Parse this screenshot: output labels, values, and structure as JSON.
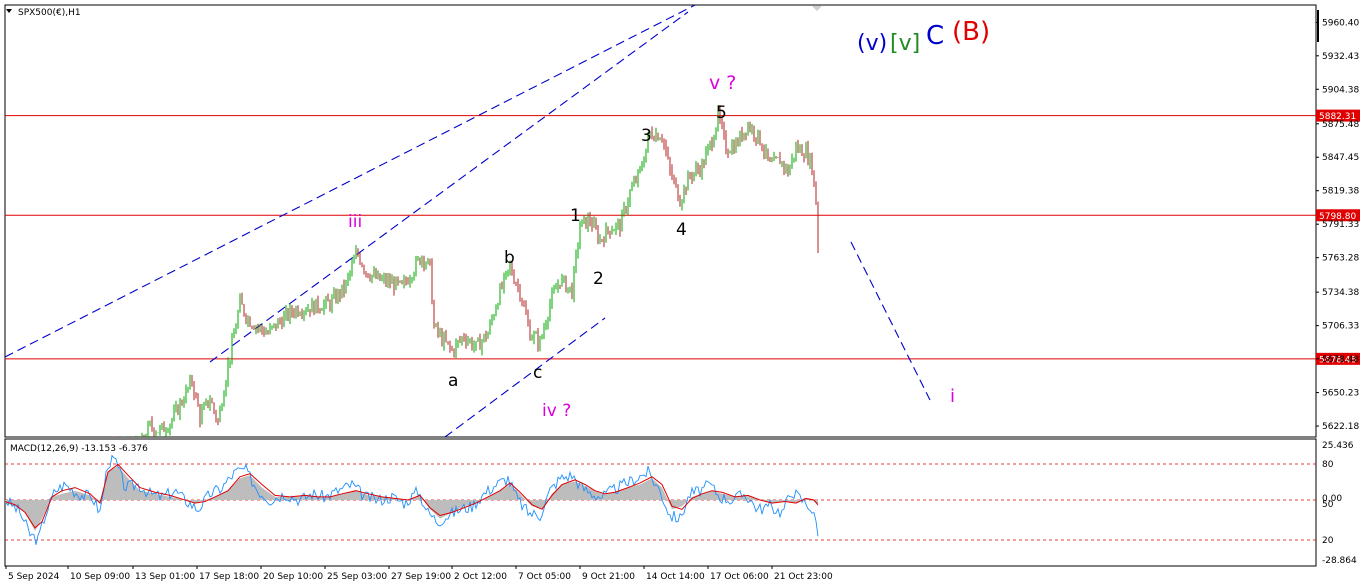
{
  "header": {
    "symbol": "SPX500(€),H1",
    "macd_label": "MACD(12,26,9) -13.153 -6.376"
  },
  "colors": {
    "up": "#00aa00",
    "down": "#b22222",
    "level": "#e00000",
    "trend": "#0000cc",
    "macd_hist": "#bdbdbd",
    "macd_main": "#1e90ff",
    "macd_signal": "#e00000",
    "label_magenta": "#dd00dd",
    "label_black": "#000000",
    "label_blue": "#0000cc",
    "label_green": "#228b22",
    "label_red": "#e00000"
  },
  "chart_data": [
    {
      "type": "candlestick",
      "ylim": [
        5613,
        5975
      ],
      "y_ticks": [
        "5960.40",
        "5932.43",
        "5904.38",
        "5875.48",
        "5847.45",
        "5819.38",
        "5791.33",
        "5763.28",
        "5734.38",
        "5706.33",
        "5678.48",
        "5650.23",
        "5622.18"
      ],
      "x_labels": [
        "5 Sep 2024",
        "10 Sep 09:00",
        "13 Sep 01:00",
        "17 Sep 18:00",
        "20 Sep 10:00",
        "25 Sep 03:00",
        "27 Sep 19:00",
        "2 Oct 12:00",
        "7 Oct 05:00",
        "9 Oct 21:00",
        "14 Oct 14:00",
        "17 Oct 06:00",
        "21 Oct 23:00"
      ],
      "price_levels": [
        {
          "value": 5882.31,
          "label": "5882.31"
        },
        {
          "value": 5798.8,
          "label": "5798.80"
        },
        {
          "value": 5678.48,
          "label": "5678.48"
        }
      ],
      "price_path": [
        [
          0,
          5600
        ],
        [
          140,
          5605
        ],
        [
          150,
          5622
        ],
        [
          160,
          5618
        ],
        [
          170,
          5625
        ],
        [
          180,
          5640
        ],
        [
          192,
          5660
        ],
        [
          200,
          5630
        ],
        [
          210,
          5645
        ],
        [
          218,
          5625
        ],
        [
          225,
          5660
        ],
        [
          232,
          5690
        ],
        [
          240,
          5725
        ],
        [
          248,
          5712
        ],
        [
          258,
          5705
        ],
        [
          268,
          5700
        ],
        [
          280,
          5710
        ],
        [
          295,
          5720
        ],
        [
          312,
          5722
        ],
        [
          330,
          5725
        ],
        [
          345,
          5738
        ],
        [
          357,
          5768
        ],
        [
          366,
          5752
        ],
        [
          378,
          5745
        ],
        [
          392,
          5742
        ],
        [
          402,
          5738
        ],
        [
          412,
          5752
        ],
        [
          422,
          5765
        ],
        [
          430,
          5755
        ],
        [
          434,
          5705
        ],
        [
          442,
          5695
        ],
        [
          452,
          5685
        ],
        [
          464,
          5698
        ],
        [
          476,
          5688
        ],
        [
          488,
          5700
        ],
        [
          498,
          5730
        ],
        [
          510,
          5755
        ],
        [
          520,
          5735
        ],
        [
          530,
          5700
        ],
        [
          540,
          5692
        ],
        [
          550,
          5725
        ],
        [
          560,
          5745
        ],
        [
          572,
          5735
        ],
        [
          580,
          5790
        ],
        [
          590,
          5795
        ],
        [
          600,
          5778
        ],
        [
          610,
          5788
        ],
        [
          620,
          5790
        ],
        [
          630,
          5818
        ],
        [
          640,
          5835
        ],
        [
          650,
          5868
        ],
        [
          662,
          5866
        ],
        [
          670,
          5835
        ],
        [
          680,
          5812
        ],
        [
          690,
          5832
        ],
        [
          702,
          5840
        ],
        [
          712,
          5862
        ],
        [
          718,
          5882
        ],
        [
          726,
          5855
        ],
        [
          736,
          5858
        ],
        [
          748,
          5875
        ],
        [
          760,
          5862
        ],
        [
          770,
          5840
        ],
        [
          780,
          5845
        ],
        [
          788,
          5835
        ],
        [
          796,
          5855
        ],
        [
          806,
          5852
        ],
        [
          812,
          5840
        ],
        [
          816,
          5810
        ],
        [
          818,
          5770
        ]
      ],
      "wave_labels": [
        {
          "text": "iii",
          "color": "label_magenta"
        },
        {
          "text": "b",
          "color": "label_black"
        },
        {
          "text": "1",
          "color": "label_black"
        },
        {
          "text": "2",
          "color": "label_black"
        },
        {
          "text": "3",
          "color": "label_black"
        },
        {
          "text": "4",
          "color": "label_black"
        },
        {
          "text": "5",
          "color": "label_black"
        },
        {
          "text": "v ?",
          "color": "label_magenta"
        },
        {
          "text": "a",
          "color": "label_black"
        },
        {
          "text": "c",
          "color": "label_black"
        },
        {
          "text": "iv ?",
          "color": "label_magenta"
        },
        {
          "text": "i",
          "color": "label_magenta"
        },
        {
          "text": "(v)",
          "color": "label_blue"
        },
        {
          "text": "[v]",
          "color": "label_green"
        },
        {
          "text": "C",
          "color": "label_blue"
        },
        {
          "text": "(B)",
          "color": "label_red"
        }
      ]
    },
    {
      "type": "macd",
      "ylim": [
        -28.864,
        25.436
      ],
      "y_ticks": [
        "25.436",
        "80",
        "0.00",
        "50",
        "20",
        "-28.864"
      ],
      "reference_levels": [
        16.5,
        0,
        -16.5
      ],
      "histogram_path": [
        [
          0,
          -1
        ],
        [
          15,
          -4
        ],
        [
          25,
          -8
        ],
        [
          35,
          -20
        ],
        [
          42,
          -12
        ],
        [
          52,
          2
        ],
        [
          62,
          4
        ],
        [
          75,
          6
        ],
        [
          90,
          3
        ],
        [
          100,
          -2
        ],
        [
          108,
          18
        ],
        [
          118,
          22
        ],
        [
          128,
          14
        ],
        [
          140,
          6
        ],
        [
          155,
          4
        ],
        [
          170,
          2
        ],
        [
          180,
          1
        ],
        [
          195,
          -2
        ],
        [
          205,
          0
        ],
        [
          215,
          2
        ],
        [
          228,
          6
        ],
        [
          240,
          14
        ],
        [
          250,
          16
        ],
        [
          262,
          8
        ],
        [
          275,
          2
        ],
        [
          290,
          2
        ],
        [
          305,
          3
        ],
        [
          318,
          2
        ],
        [
          330,
          2
        ],
        [
          342,
          4
        ],
        [
          356,
          6
        ],
        [
          368,
          3
        ],
        [
          382,
          2
        ],
        [
          396,
          1
        ],
        [
          408,
          0
        ],
        [
          420,
          3
        ],
        [
          430,
          -6
        ],
        [
          440,
          -12
        ],
        [
          452,
          -8
        ],
        [
          464,
          -4
        ],
        [
          476,
          -2
        ],
        [
          488,
          2
        ],
        [
          500,
          6
        ],
        [
          510,
          10
        ],
        [
          520,
          4
        ],
        [
          532,
          -4
        ],
        [
          542,
          -6
        ],
        [
          552,
          4
        ],
        [
          562,
          10
        ],
        [
          575,
          12
        ],
        [
          585,
          9
        ],
        [
          595,
          6
        ],
        [
          605,
          4
        ],
        [
          615,
          5
        ],
        [
          628,
          8
        ],
        [
          640,
          10
        ],
        [
          652,
          14
        ],
        [
          662,
          8
        ],
        [
          672,
          -6
        ],
        [
          682,
          -4
        ],
        [
          692,
          2
        ],
        [
          702,
          4
        ],
        [
          712,
          6
        ],
        [
          722,
          4
        ],
        [
          735,
          2
        ],
        [
          748,
          3
        ],
        [
          760,
          0
        ],
        [
          772,
          -2
        ],
        [
          785,
          -1
        ],
        [
          796,
          -2
        ],
        [
          806,
          1
        ],
        [
          814,
          -1
        ],
        [
          818,
          -4
        ]
      ],
      "signal_path": [
        [
          0,
          0
        ],
        [
          15,
          -3
        ],
        [
          25,
          -8
        ],
        [
          35,
          -18
        ],
        [
          42,
          -14
        ],
        [
          52,
          2
        ],
        [
          62,
          6
        ],
        [
          75,
          8
        ],
        [
          90,
          4
        ],
        [
          100,
          -2
        ],
        [
          108,
          18
        ],
        [
          118,
          23
        ],
        [
          128,
          16
        ],
        [
          140,
          8
        ],
        [
          155,
          5
        ],
        [
          170,
          3
        ],
        [
          180,
          1
        ],
        [
          195,
          -2
        ],
        [
          205,
          -1
        ],
        [
          215,
          2
        ],
        [
          228,
          6
        ],
        [
          240,
          15
        ],
        [
          250,
          17
        ],
        [
          262,
          10
        ],
        [
          275,
          3
        ],
        [
          290,
          2
        ],
        [
          305,
          3
        ],
        [
          318,
          2
        ],
        [
          330,
          2
        ],
        [
          342,
          4
        ],
        [
          356,
          6
        ],
        [
          368,
          4
        ],
        [
          382,
          2
        ],
        [
          396,
          1
        ],
        [
          408,
          0
        ],
        [
          420,
          3
        ],
        [
          430,
          -5
        ],
        [
          440,
          -10
        ],
        [
          452,
          -8
        ],
        [
          464,
          -5
        ],
        [
          476,
          -2
        ],
        [
          488,
          2
        ],
        [
          500,
          6
        ],
        [
          510,
          11
        ],
        [
          520,
          5
        ],
        [
          532,
          -3
        ],
        [
          542,
          -6
        ],
        [
          552,
          3
        ],
        [
          562,
          10
        ],
        [
          575,
          13
        ],
        [
          585,
          10
        ],
        [
          595,
          6
        ],
        [
          605,
          4
        ],
        [
          615,
          5
        ],
        [
          628,
          8
        ],
        [
          640,
          11
        ],
        [
          652,
          15
        ],
        [
          662,
          10
        ],
        [
          672,
          -4
        ],
        [
          682,
          -6
        ],
        [
          692,
          1
        ],
        [
          702,
          4
        ],
        [
          712,
          6
        ],
        [
          722,
          5
        ],
        [
          735,
          2
        ],
        [
          748,
          3
        ],
        [
          760,
          0
        ],
        [
          772,
          -2
        ],
        [
          785,
          -1
        ],
        [
          796,
          -2
        ],
        [
          806,
          1
        ],
        [
          814,
          0
        ],
        [
          818,
          -3
        ]
      ],
      "main_path": [
        [
          0,
          2
        ],
        [
          10,
          -2
        ],
        [
          20,
          -8
        ],
        [
          30,
          -22
        ],
        [
          38,
          -26
        ],
        [
          45,
          -10
        ],
        [
          55,
          6
        ],
        [
          65,
          10
        ],
        [
          78,
          4
        ],
        [
          92,
          2
        ],
        [
          100,
          -8
        ],
        [
          108,
          24
        ],
        [
          115,
          26
        ],
        [
          125,
          8
        ],
        [
          138,
          10
        ],
        [
          150,
          4
        ],
        [
          162,
          2
        ],
        [
          175,
          6
        ],
        [
          185,
          0
        ],
        [
          198,
          -6
        ],
        [
          210,
          4
        ],
        [
          222,
          8
        ],
        [
          235,
          18
        ],
        [
          245,
          20
        ],
        [
          258,
          6
        ],
        [
          270,
          0
        ],
        [
          285,
          4
        ],
        [
          300,
          0
        ],
        [
          312,
          4
        ],
        [
          325,
          2
        ],
        [
          338,
          6
        ],
        [
          352,
          10
        ],
        [
          365,
          2
        ],
        [
          378,
          0
        ],
        [
          392,
          2
        ],
        [
          405,
          -2
        ],
        [
          418,
          6
        ],
        [
          428,
          -8
        ],
        [
          438,
          -14
        ],
        [
          448,
          -10
        ],
        [
          460,
          -6
        ],
        [
          472,
          -4
        ],
        [
          484,
          4
        ],
        [
          496,
          10
        ],
        [
          508,
          14
        ],
        [
          518,
          0
        ],
        [
          528,
          -8
        ],
        [
          540,
          -10
        ],
        [
          550,
          6
        ],
        [
          560,
          14
        ],
        [
          572,
          16
        ],
        [
          582,
          8
        ],
        [
          592,
          4
        ],
        [
          602,
          2
        ],
        [
          612,
          6
        ],
        [
          624,
          10
        ],
        [
          636,
          14
        ],
        [
          648,
          18
        ],
        [
          660,
          6
        ],
        [
          670,
          -10
        ],
        [
          680,
          -12
        ],
        [
          690,
          4
        ],
        [
          700,
          6
        ],
        [
          710,
          10
        ],
        [
          720,
          2
        ],
        [
          732,
          0
        ],
        [
          745,
          4
        ],
        [
          758,
          -6
        ],
        [
          770,
          -4
        ],
        [
          782,
          -8
        ],
        [
          792,
          6
        ],
        [
          802,
          0
        ],
        [
          810,
          -4
        ],
        [
          816,
          -14
        ],
        [
          818,
          -20
        ]
      ]
    }
  ]
}
